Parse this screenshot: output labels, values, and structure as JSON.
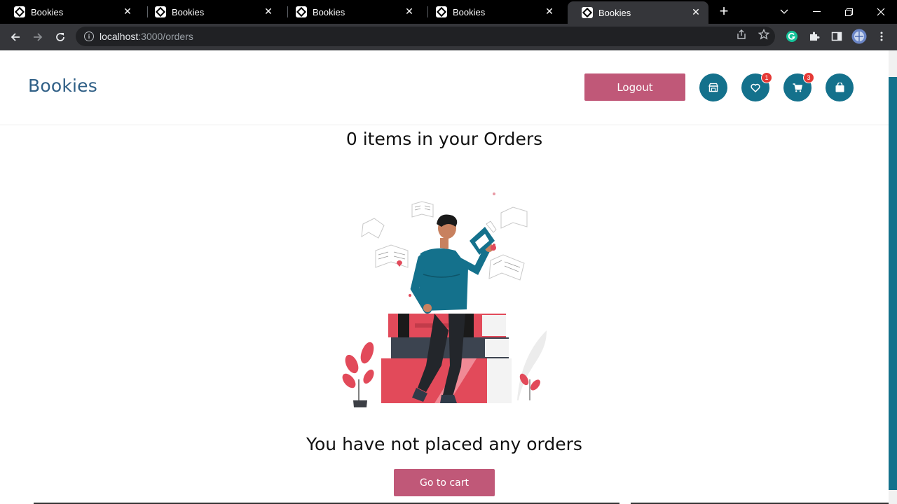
{
  "browser": {
    "tabs": [
      {
        "title": "Bookies"
      },
      {
        "title": "Bookies"
      },
      {
        "title": "Bookies"
      },
      {
        "title": "Bookies"
      },
      {
        "title": "Bookies",
        "active": true
      }
    ],
    "url_host": "localhost",
    "url_path": ":3000/orders"
  },
  "header": {
    "brand": "Bookies",
    "logout_label": "Logout",
    "wishlist_count": "1",
    "cart_count": "3"
  },
  "main": {
    "heading": "0 items in your Orders",
    "empty_message": "You have not placed any orders",
    "go_to_cart_label": "Go to cart"
  },
  "colors": {
    "brand_text": "#2f5f86",
    "primary_button": "#c05878",
    "icon_button": "#14718c",
    "badge": "#e53935"
  }
}
